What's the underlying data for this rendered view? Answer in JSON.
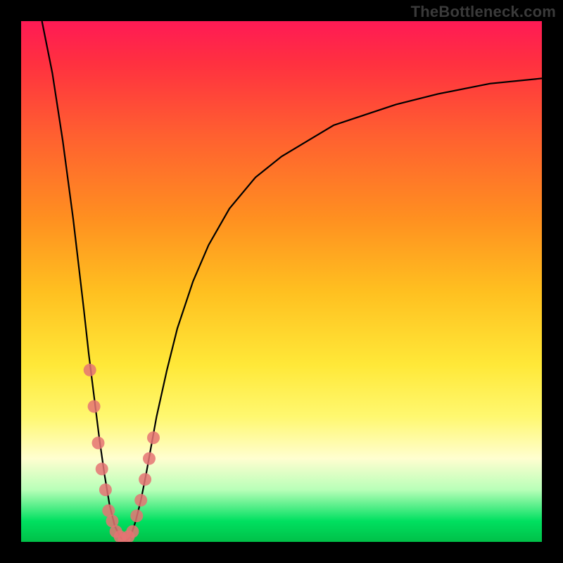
{
  "brand": "TheBottleneck.com",
  "chart_data": {
    "type": "line",
    "title": "",
    "xlabel": "",
    "ylabel": "",
    "xlim": [
      0,
      100
    ],
    "ylim": [
      0,
      100
    ],
    "grid": false,
    "legend": false,
    "series": [
      {
        "name": "bottleneck-curve",
        "x": [
          4,
          6,
          8,
          10,
          12,
          13,
          14,
          15,
          16,
          17,
          18,
          19,
          20,
          21,
          22,
          23,
          24,
          26,
          28,
          30,
          33,
          36,
          40,
          45,
          50,
          55,
          60,
          66,
          72,
          80,
          90,
          100
        ],
        "y": [
          100,
          90,
          77,
          62,
          45,
          36,
          28,
          20,
          13,
          7,
          3,
          1,
          0,
          1,
          4,
          8,
          13,
          24,
          33,
          41,
          50,
          57,
          64,
          70,
          74,
          77,
          80,
          82,
          84,
          86,
          88,
          89
        ]
      }
    ],
    "markers": {
      "name": "hardware-samples",
      "x": [
        13.2,
        14.0,
        14.8,
        15.5,
        16.2,
        16.8,
        17.5,
        18.2,
        19.0,
        19.8,
        20.6,
        21.4,
        22.2,
        23.0,
        23.8,
        24.6,
        25.4
      ],
      "y": [
        33,
        26,
        19,
        14,
        10,
        6,
        4,
        2,
        1,
        0.5,
        1,
        2,
        5,
        8,
        12,
        16,
        20
      ],
      "color": "#e57373"
    },
    "background": "heat-gradient"
  }
}
